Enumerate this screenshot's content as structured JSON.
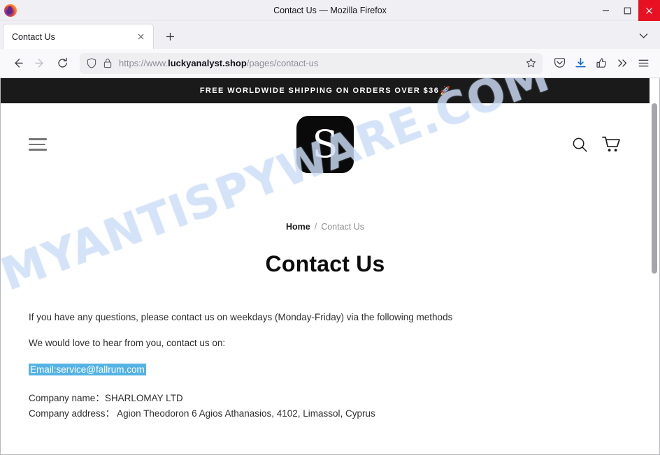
{
  "browser": {
    "window_title": "Contact Us — Mozilla Firefox",
    "app_icon": "firefox-logo",
    "window_controls": {
      "minimize": "minimize-icon",
      "maximize": "maximize-icon",
      "close": "close-icon"
    },
    "tabs": [
      {
        "title": "Contact Us",
        "active": true,
        "close_icon": "close-icon"
      }
    ],
    "new_tab_label": "+",
    "tab_list_dropdown": "chevron-down-icon",
    "toolbar": {
      "back": "back-arrow-icon",
      "forward": "forward-arrow-icon",
      "reload": "reload-icon",
      "shield": "shield-icon",
      "lock": "lock-icon",
      "url_scheme": "https://www.",
      "url_domain": "luckyanalyst.shop",
      "url_path": "/pages/contact-us",
      "url_full": "https://www.luckyanalyst.shop/pages/contact-us",
      "bookmark": "star-icon",
      "pocket": "pocket-icon",
      "downloads": "download-icon",
      "account": "account-icon",
      "overflow": "double-chevron-icon",
      "app_menu": "hamburger-menu-icon"
    }
  },
  "page": {
    "announcement": {
      "text": "FREE WORLDWIDE SHIPPING ON ORDERS OVER $36",
      "emoji": "🚀",
      "background": "#1a1a1a",
      "color": "#ffffff"
    },
    "header": {
      "menu_icon": "hamburger-menu-icon",
      "logo_letter": "S",
      "logo_background": "#0a0a0a",
      "search_icon": "search-icon",
      "cart_icon": "shopping-cart-icon"
    },
    "breadcrumb": {
      "home": "Home",
      "separator": "/",
      "current": "Contact Us"
    },
    "title": "Contact Us",
    "body": {
      "paragraph1": "If you have any questions, please contact us on weekdays (Monday-Friday) via the following methods",
      "paragraph2": "We would love to hear from you, contact us on:",
      "email": "Email:service@fallrum.com",
      "email_highlight_color": "#54b3e4",
      "company_name_label": "Company name：",
      "company_name_value": "SHARLOMAY LTD",
      "company_address_label": "Company address：",
      "company_address_value": " Agion Theodoron 6 Agios Athanasios, 4102, Limassol, Cyprus"
    },
    "watermark": "MYANTISPYWARE.COM",
    "scrollbar": "vertical-scrollbar"
  }
}
